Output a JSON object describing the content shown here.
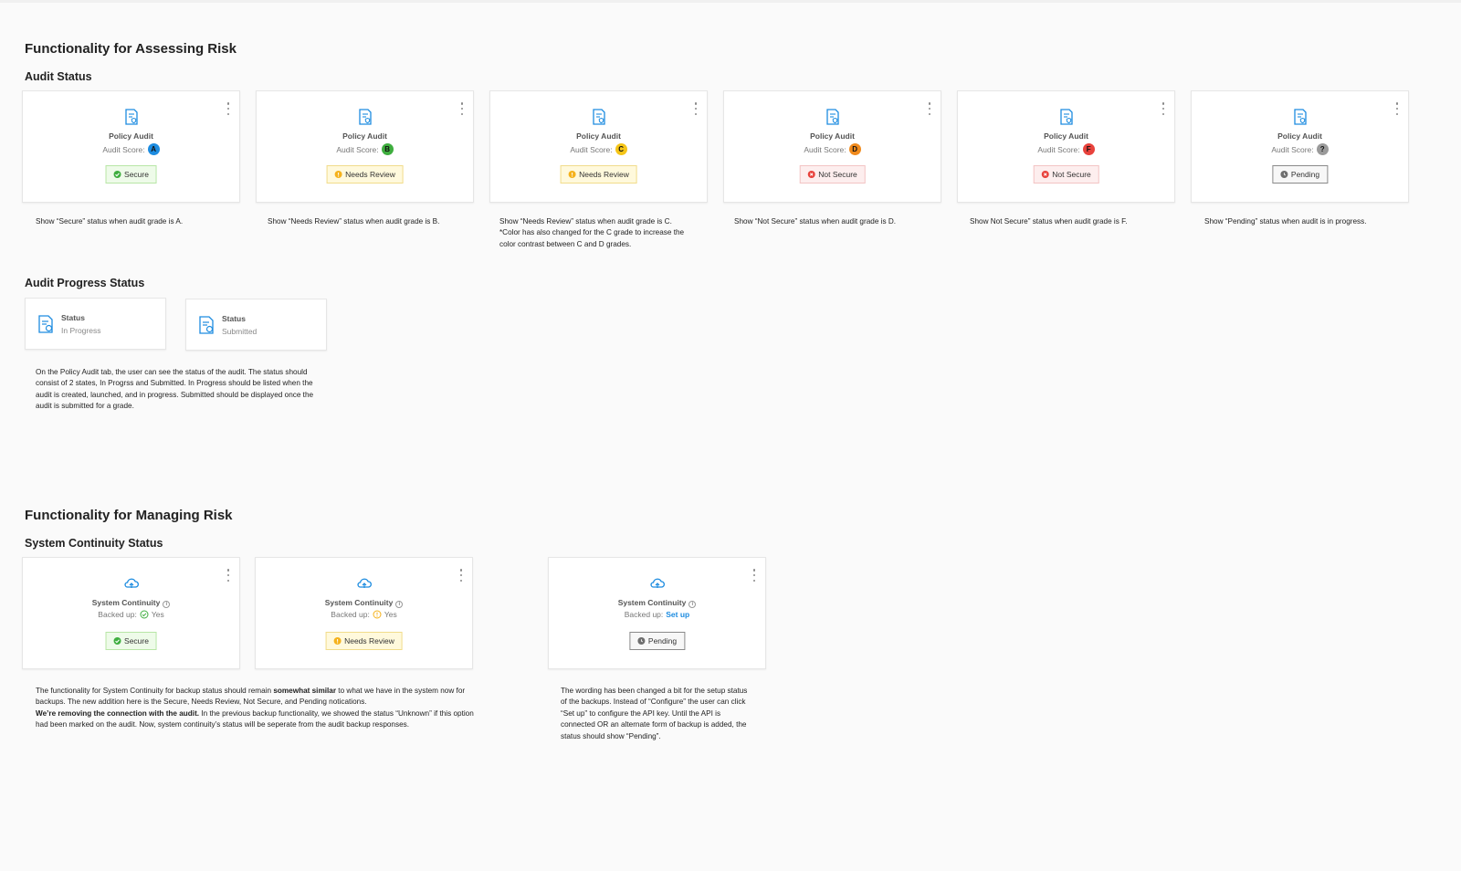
{
  "assess": {
    "title": "Functionality for Assessing Risk",
    "audit_status_title": "Audit Status",
    "cards": [
      {
        "title": "Policy Audit",
        "score_label": "Audit Score:",
        "grade": "A",
        "grade_color": "#1d8ce0",
        "badge": "Secure",
        "badge_type": "secure",
        "note": "Show “Secure” status when audit grade is A."
      },
      {
        "title": "Policy Audit",
        "score_label": "Audit Score:",
        "grade": "B",
        "grade_color": "#3fae3f",
        "badge": "Needs Review",
        "badge_type": "review",
        "note": "Show “Needs Review” status when audit grade is B."
      },
      {
        "title": "Policy Audit",
        "score_label": "Audit Score:",
        "grade": "C",
        "grade_color": "#f5c518",
        "badge": "Needs Review",
        "badge_type": "review",
        "note": "Show “Needs Review” status when audit grade is C.",
        "note2": "*Color has also changed for the C grade to increase the",
        "note3": "color contrast between C and D grades."
      },
      {
        "title": "Policy Audit",
        "score_label": "Audit Score:",
        "grade": "D",
        "grade_color": "#f08a1c",
        "badge": "Not Secure",
        "badge_type": "notsecure",
        "note": "Show “Not Secure” status when audit grade is D."
      },
      {
        "title": "Policy Audit",
        "score_label": "Audit Score:",
        "grade": "F",
        "grade_color": "#e8423c",
        "badge": "Not Secure",
        "badge_type": "notsecure",
        "note": "Show Not Secure” status when audit grade is F."
      },
      {
        "title": "Policy Audit",
        "score_label": "Audit Score:",
        "grade": "?",
        "grade_color": "#9a9a9a",
        "badge": "Pending",
        "badge_type": "pending",
        "note": "Show “Pending” status when audit is in progress."
      }
    ],
    "progress_title": "Audit Progress Status",
    "progress_cards": [
      {
        "label": "Status",
        "value": "In Progress"
      },
      {
        "label": "Status",
        "value": "Submitted"
      }
    ],
    "progress_note": [
      "On the Policy Audit tab, the user can see the status of the audit. The status should",
      "consist of 2 states, In Progrss and Submitted. In Progress should be listed when the",
      "audit is created, launched, and in progress. Submitted should be displayed once the",
      "audit is submitted for a grade."
    ]
  },
  "manage": {
    "title": "Functionality for Managing Risk",
    "continuity_title": "System Continuity Status",
    "cards": [
      {
        "title": "System Continuity",
        "backed_label": "Backed up:",
        "backed_value": "Yes",
        "badge": "Secure",
        "badge_type": "secure"
      },
      {
        "title": "System Continuity",
        "backed_label": "Backed up:",
        "backed_value": "Yes",
        "badge": "Needs Review",
        "badge_type": "review"
      },
      {
        "title": "System Continuity",
        "backed_label": "Backed up:",
        "backed_link": "Set up",
        "badge": "Pending",
        "badge_type": "pending"
      }
    ],
    "note_left": {
      "l1a": "The functionality for System Continuity for backup status should remain ",
      "l1b": "somewhat similar",
      "l1c": " to what we have in the system now for",
      "l2": "backups. The new addition here is the Secure, Needs Review, Not Secure, and Pending notications.",
      "l3a": "We’re removing the connection with the audit.",
      "l3b": " In the previous backup functionality, we showed the status “Unknown” if this option",
      "l4": "had been marked on the audit. Now, system continuity’s status will be seperate from the audit backup responses."
    },
    "note_right": [
      "The wording has been changed a bit for the setup status",
      "of the backups. Instead of “Configure” the user can click",
      "“Set up” to configure the API key. Until the API is",
      "connected OR an alternate form of backup is added, the",
      "status should show “Pending”."
    ]
  },
  "colors": {
    "secure": "#3fae3f",
    "review": "#f5b21c",
    "notsecure": "#e8423c",
    "pending": "#6e6e6e",
    "accent": "#1d8ce0"
  }
}
